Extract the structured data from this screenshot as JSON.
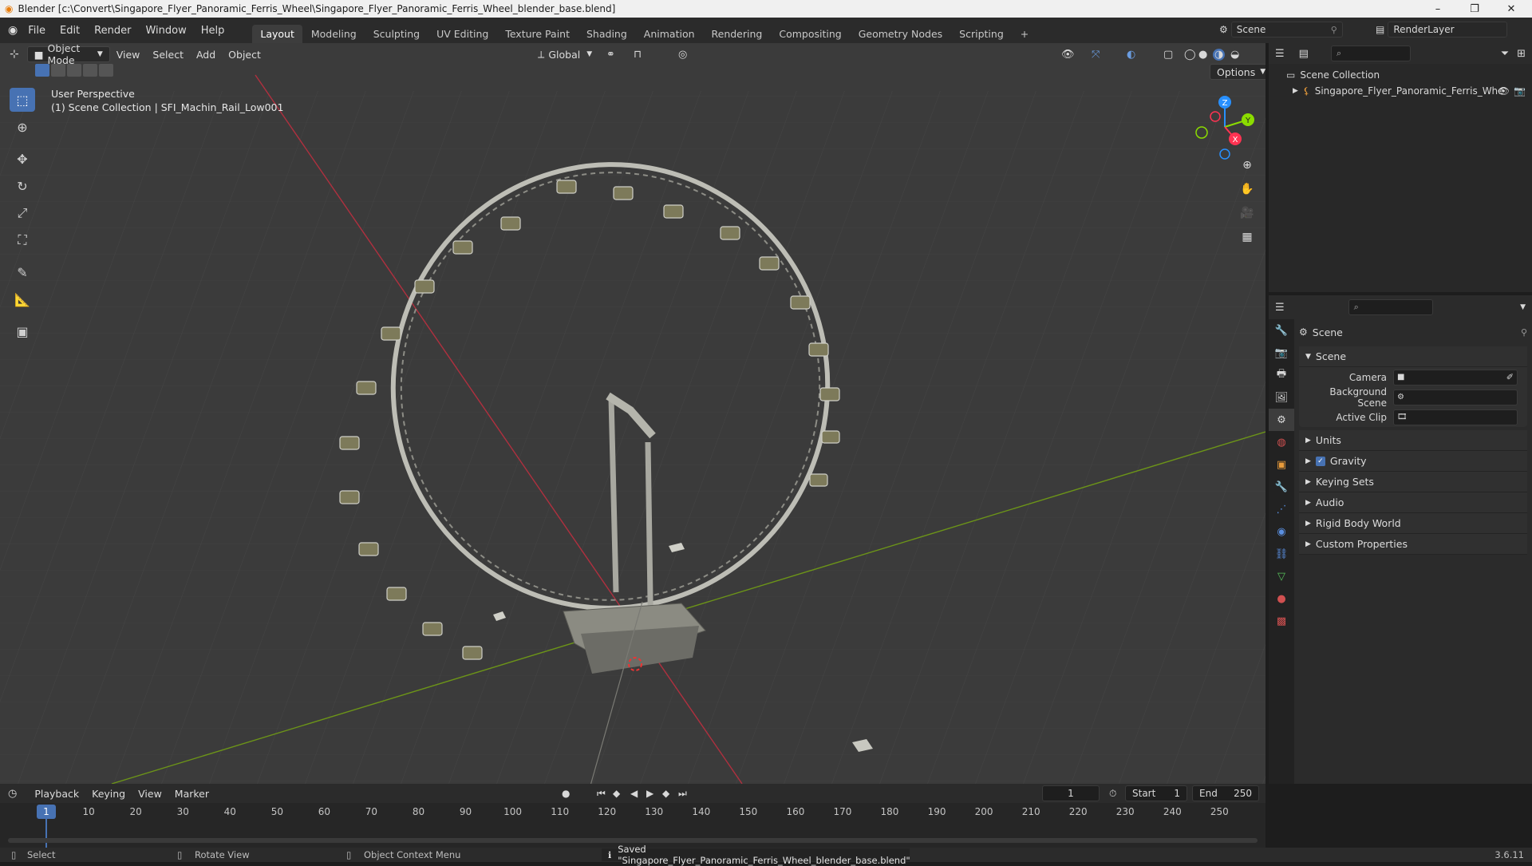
{
  "titlebar": {
    "title": "Blender [c:\\Convert\\Singapore_Flyer_Panoramic_Ferris_Wheel\\Singapore_Flyer_Panoramic_Ferris_Wheel_blender_base.blend]",
    "minimize": "–",
    "maximize": "❐",
    "close": "✕"
  },
  "menubar": {
    "items": [
      "File",
      "Edit",
      "Render",
      "Window",
      "Help"
    ],
    "workspaces": [
      "Layout",
      "Modeling",
      "Sculpting",
      "UV Editing",
      "Texture Paint",
      "Shading",
      "Animation",
      "Rendering",
      "Compositing",
      "Geometry Nodes",
      "Scripting"
    ],
    "add_tab": "+",
    "scene_label": "Scene",
    "layer_label": "RenderLayer"
  },
  "viewport": {
    "mode": "Object Mode",
    "menus": [
      "View",
      "Select",
      "Add",
      "Object"
    ],
    "transform": "Global",
    "options": "Options",
    "perspective": "User Perspective",
    "collection_info": "(1) Scene Collection | SFI_Machin_Rail_Low001",
    "gizmo": {
      "x": "X",
      "y": "Y",
      "z": "Z"
    }
  },
  "outliner": {
    "root": "Scene Collection",
    "item": "Singapore_Flyer_Panoramic_Ferris_Whe"
  },
  "properties": {
    "context_title": "Scene",
    "section": "Scene",
    "fields": [
      {
        "label": "Camera",
        "value": ""
      },
      {
        "label": "Background Scene",
        "value": ""
      },
      {
        "label": "Active Clip",
        "value": ""
      }
    ],
    "panels": [
      "Units",
      "Gravity",
      "Keying Sets",
      "Audio",
      "Rigid Body World",
      "Custom Properties"
    ],
    "gravity_checked": true
  },
  "timeline": {
    "menus": [
      "Playback",
      "Keying",
      "View",
      "Marker"
    ],
    "current_frame": "1",
    "start_label": "Start",
    "start_value": "1",
    "end_label": "End",
    "end_value": "250",
    "ticks": [
      "1",
      "10",
      "20",
      "30",
      "40",
      "50",
      "60",
      "70",
      "80",
      "90",
      "100",
      "110",
      "120",
      "130",
      "140",
      "150",
      "160",
      "170",
      "180",
      "190",
      "200",
      "210",
      "220",
      "230",
      "240",
      "250"
    ]
  },
  "statusbar": {
    "select": "Select",
    "rotate": "Rotate View",
    "context_menu": "Object Context Menu",
    "message": "Saved \"Singapore_Flyer_Panoramic_Ferris_Wheel_blender_base.blend\"",
    "version": "3.6.11"
  },
  "colors": {
    "accent": "#4772b3",
    "x_axis": "#ff3352",
    "y_axis": "#8bdc00",
    "z_axis": "#2890ff"
  }
}
